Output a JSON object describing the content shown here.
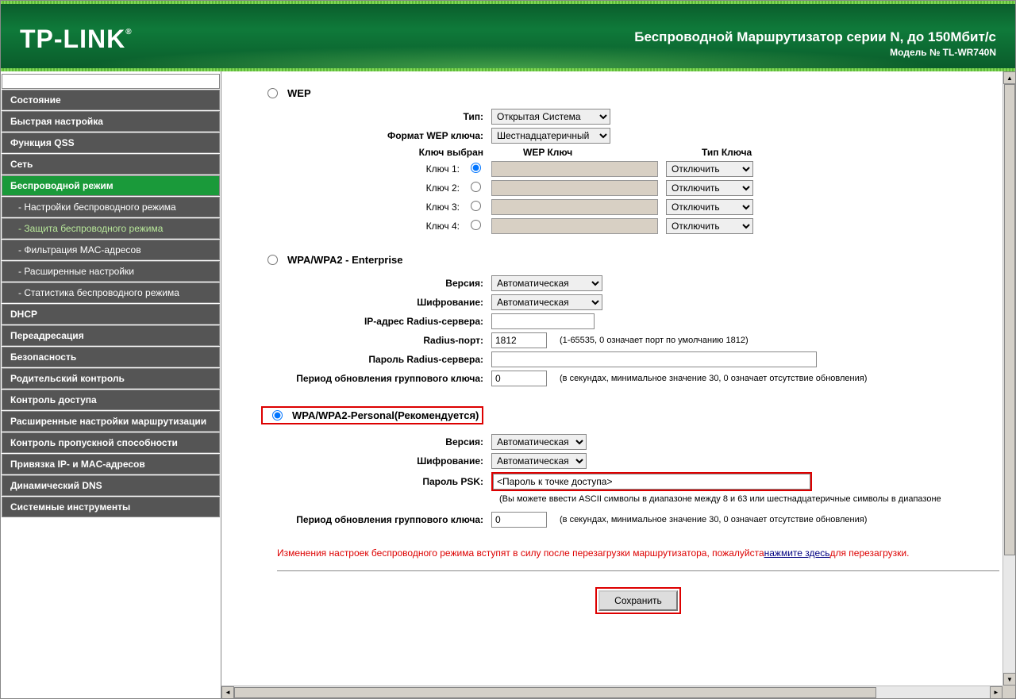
{
  "header": {
    "logo": "TP-LINK",
    "title": "Беспроводной Маршрутизатор серии N, до 150Мбит/с",
    "subtitle": "Модель № TL-WR740N"
  },
  "sidebar": {
    "items": [
      {
        "label": "Состояние",
        "cls": ""
      },
      {
        "label": "Быстрая настройка",
        "cls": ""
      },
      {
        "label": "Функция QSS",
        "cls": ""
      },
      {
        "label": "Сеть",
        "cls": ""
      },
      {
        "label": "Беспроводной режим",
        "cls": "active"
      },
      {
        "label": "- Настройки беспроводного режима",
        "cls": "sub"
      },
      {
        "label": "- Защита беспроводного режима",
        "cls": "sub current"
      },
      {
        "label": "- Фильтрация MAC-адресов",
        "cls": "sub"
      },
      {
        "label": "- Расширенные настройки",
        "cls": "sub"
      },
      {
        "label": "- Статистика беспроводного режима",
        "cls": "sub"
      },
      {
        "label": "DHCP",
        "cls": ""
      },
      {
        "label": "Переадресация",
        "cls": ""
      },
      {
        "label": "Безопасность",
        "cls": ""
      },
      {
        "label": "Родительский контроль",
        "cls": ""
      },
      {
        "label": "Контроль доступа",
        "cls": ""
      },
      {
        "label": "Расширенные настройки маршрутизации",
        "cls": ""
      },
      {
        "label": "Контроль пропускной способности",
        "cls": ""
      },
      {
        "label": "Привязка IP- и MAC-адресов",
        "cls": ""
      },
      {
        "label": "Динамический DNS",
        "cls": ""
      },
      {
        "label": "Системные инструменты",
        "cls": ""
      }
    ]
  },
  "wep": {
    "title": "WEP",
    "type_label": "Тип:",
    "type_value": "Открытая Система",
    "keyformat_label": "Формат WEP ключа:",
    "keyformat_value": "Шестнадцатеричный",
    "keyselected_label": "Ключ выбран",
    "wepkey_header": "WEP Ключ",
    "keytype_header": "Тип Ключа",
    "keys": [
      {
        "label": "Ключ 1:",
        "selected": true,
        "type": "Отключить"
      },
      {
        "label": "Ключ 2:",
        "selected": false,
        "type": "Отключить"
      },
      {
        "label": "Ключ 3:",
        "selected": false,
        "type": "Отключить"
      },
      {
        "label": "Ключ 4:",
        "selected": false,
        "type": "Отключить"
      }
    ]
  },
  "enterprise": {
    "title": "WPA/WPA2 - Enterprise",
    "version_label": "Версия:",
    "version_value": "Автоматическая",
    "cipher_label": "Шифрование:",
    "cipher_value": "Автоматическая",
    "radiusip_label": "IP-адрес Radius-сервера:",
    "radiusip_value": "",
    "radiusport_label": "Radius-порт:",
    "radiusport_value": "1812",
    "radiusport_hint": "(1-65535, 0 означает порт по умолчанию 1812)",
    "radiuspass_label": "Пароль Radius-сервера:",
    "radiuspass_value": "",
    "rekey_label": "Период обновления группового ключа:",
    "rekey_value": "0",
    "rekey_hint": "(в секундах, минимальное значение 30, 0 означает отсутствие обновления)"
  },
  "personal": {
    "title": "WPA/WPA2-Personal(Рекомендуется)",
    "version_label": "Версия:",
    "version_value": "Автоматическая",
    "cipher_label": "Шифрование:",
    "cipher_value": "Автоматическая",
    "psk_label": "Пароль PSK:",
    "psk_value": "<Пароль к точке доступа>",
    "psk_hint": "(Вы можете ввести ASCII символы в диапазоне между 8 и 63 или шестнадцатеричные символы в диапазоне",
    "rekey_label": "Период обновления группового ключа:",
    "rekey_value": "0",
    "rekey_hint": "(в секундах, минимальное значение 30, 0 означает отсутствие обновления)"
  },
  "warning": {
    "text_before": "Изменения настроек беспроводного режима вступят в силу после перезагрузки маршрутизатора, пожалуйста",
    "link": "нажмите здесь",
    "text_after": "для перезагрузки."
  },
  "save_label": "Сохранить"
}
